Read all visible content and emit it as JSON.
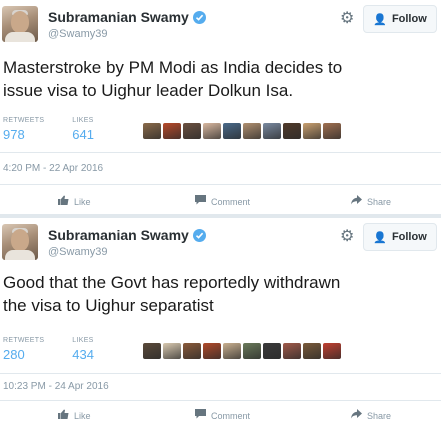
{
  "tweets": [
    {
      "name": "Subramanian Swamy",
      "handle": "@Swamy39",
      "follow_label": "Follow",
      "text_line1": "Masterstroke by PM Modi as India decides to",
      "text_line2": "issue visa to Uighur leader Dolkun Isa.",
      "retweets_label": "RETWEETS",
      "retweets": "978",
      "likes_label": "LIKES",
      "likes": "641",
      "timestamp": "4:20 PM - 22 Apr 2016",
      "like_label": "Like",
      "comment_label": "Comment",
      "share_label": "Share",
      "face_colors": [
        "#8a6a4a",
        "#b74a2a",
        "#6b5040",
        "#d9b8a0",
        "#4a6a8a",
        "#b09070",
        "#7a8aa0",
        "#503a2a",
        "#c9a070",
        "#a07050"
      ]
    },
    {
      "name": "Subramanian Swamy",
      "handle": "@Swamy39",
      "follow_label": "Follow",
      "text_line1": "Good that the Govt has reportedly withdrawn",
      "text_line2": "the visa to Uighur separatist",
      "retweets_label": "RETWEETS",
      "retweets": "280",
      "likes_label": "LIKES",
      "likes": "434",
      "timestamp": "10:23 PM - 24 Apr 2016",
      "like_label": "Like",
      "comment_label": "Comment",
      "share_label": "Share",
      "face_colors": [
        "#5a4a3a",
        "#d9c9b0",
        "#8a5a3a",
        "#b04a2a",
        "#c9b090",
        "#6a7a5a",
        "#3a3a3a",
        "#a05a4a",
        "#7a5a3a",
        "#c04030"
      ]
    }
  ],
  "icons": {
    "verified": "verified-check-icon",
    "gear": "gear-icon",
    "follow": "follow-user-icon",
    "like": "thumbs-up-icon",
    "comment": "comment-bubble-icon",
    "share": "share-arrow-icon"
  },
  "colors": {
    "accent": "#55acee",
    "muted": "#8899a6",
    "text": "#292f33",
    "divider": "#e1e8ed"
  }
}
